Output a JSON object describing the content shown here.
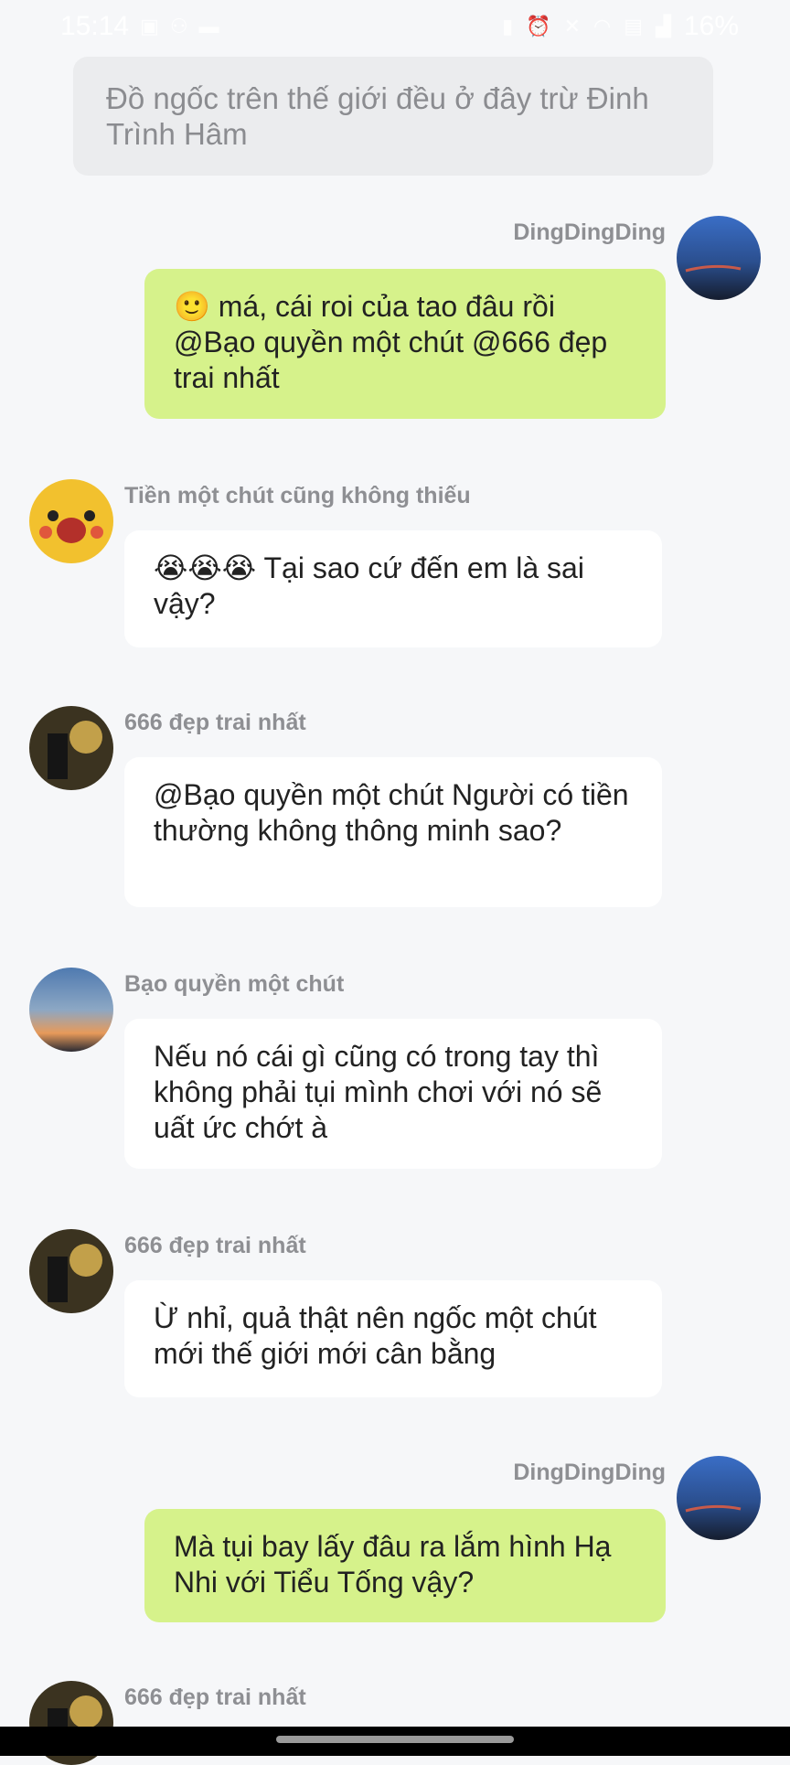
{
  "status": {
    "time": "15:14",
    "battery": "16%",
    "left_icons": [
      "image-icon",
      "people-icon",
      "message-icon"
    ],
    "right_icons": [
      "battery-saver-icon",
      "alarm-icon",
      "mute-icon",
      "wifi-icon",
      "volte-icon",
      "signal-icon"
    ]
  },
  "notice": "Đồ ngốc trên thế giới đều ở đây trừ Đinh Trình Hâm",
  "messages": [
    {
      "side": "right",
      "name": "DingDingDing",
      "emoji": "🙂",
      "text": "má, cái roi của tao đâu rồi @Bạo quyền một chút @666 đẹp trai nhất",
      "bubble_color": "#d6f28b"
    },
    {
      "side": "left",
      "name": "Tiền một chút cũng không thiếu",
      "emoji": "😭😭😭",
      "text": "Tại sao cứ đến em là sai vậy?",
      "bubble_color": "#ffffff"
    },
    {
      "side": "left",
      "name": "666 đẹp trai nhất",
      "text": "@Bạo quyền một chút Người có tiền thường không thông minh sao?",
      "bubble_color": "#ffffff"
    },
    {
      "side": "left",
      "name": "Bạo quyền một chút",
      "text": "Nếu nó cái gì cũng có trong tay thì không phải tụi mình chơi với nó sẽ uất ức chớt à",
      "bubble_color": "#ffffff"
    },
    {
      "side": "left",
      "name": "666 đẹp trai nhất",
      "text": "Ừ nhỉ, quả thật nên ngốc một chút mới thế giới mới cân bằng",
      "bubble_color": "#ffffff"
    },
    {
      "side": "right",
      "name": "DingDingDing",
      "text": "Mà tụi bay lấy đâu ra lắm hình Hạ Nhi với Tiểu Tống vậy?",
      "bubble_color": "#d6f28b"
    },
    {
      "side": "left",
      "name": "666 đẹp trai nhất"
    }
  ]
}
